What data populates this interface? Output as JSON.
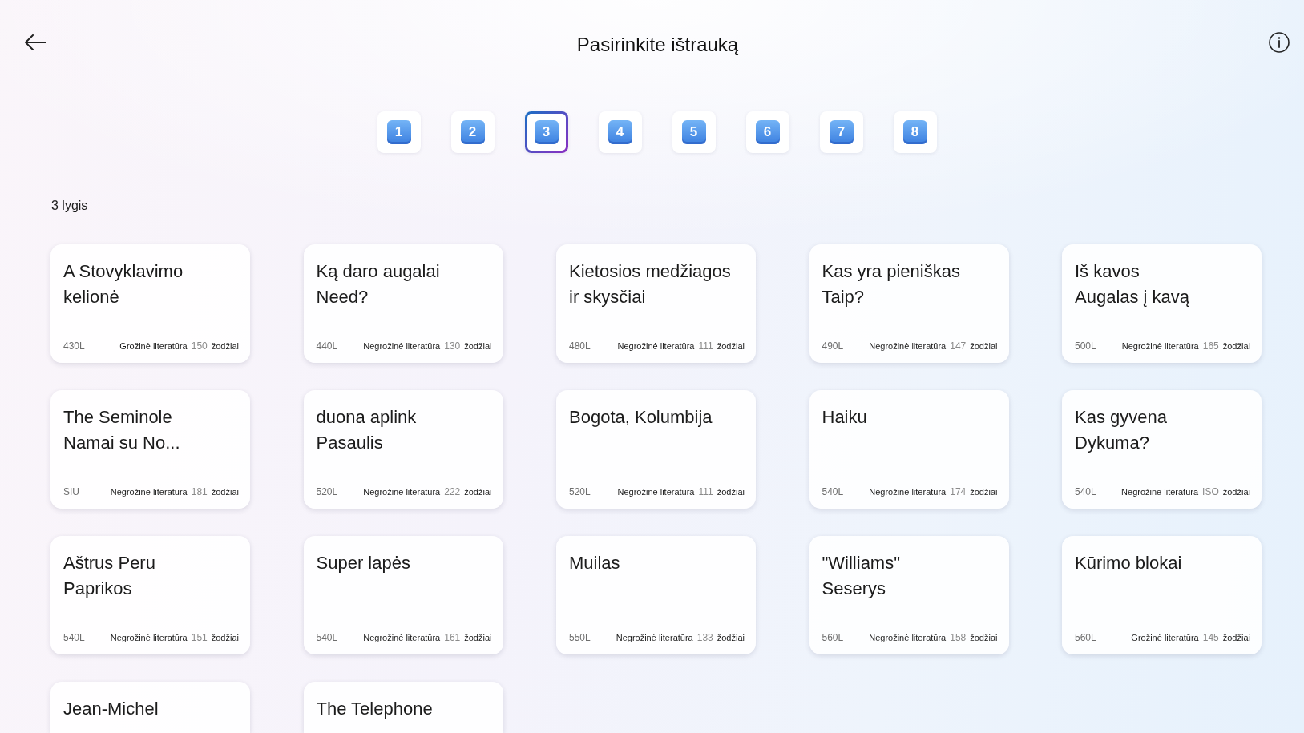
{
  "header": {
    "title": "Pasirinkite ištrauką"
  },
  "levels": [
    {
      "label": "1",
      "selected": false
    },
    {
      "label": "2",
      "selected": false
    },
    {
      "label": "3",
      "selected": true
    },
    {
      "label": "4",
      "selected": false
    },
    {
      "label": "5",
      "selected": false
    },
    {
      "label": "6",
      "selected": false
    },
    {
      "label": "7",
      "selected": false
    },
    {
      "label": "8",
      "selected": false
    }
  ],
  "level_heading": "3 lygis",
  "cards": [
    {
      "title": "A Stovyklavimo kelionė",
      "reading_level": "430L",
      "genre": "Grožinė literatūra",
      "count": "150",
      "words": "žodžiai"
    },
    {
      "title": "Ką daro augalai\nNeed?",
      "reading_level": "440L",
      "genre": "Negrožinė literatūra",
      "count": "130",
      "words": "žodžiai"
    },
    {
      "title": "Kietosios medžiagos ir skysčiai",
      "reading_level": "480L",
      "genre": "Negrožinė literatūra",
      "count": "111",
      "words": "žodžiai"
    },
    {
      "title": "Kas yra pieniškas\nTaip?",
      "reading_level": "490L",
      "genre": "Negrožinė literatūra",
      "count": "147",
      "words": "žodžiai"
    },
    {
      "title": "Iš kavos\nAugalas į kavą",
      "reading_level": "500L",
      "genre": "Negrožinė literatūra",
      "count": "165",
      "words": "žodžiai"
    },
    {
      "title": "The Seminole\nNamai su No...",
      "reading_level": "SIU",
      "genre": "Negrožinė literatūra",
      "count": "181",
      "words": "žodžiai"
    },
    {
      "title": "duona aplink\nPasaulis",
      "reading_level": "520L",
      "genre": "Negrožinė literatūra",
      "count": "222",
      "words": "žodžiai"
    },
    {
      "title": "Bogota, Kolumbija",
      "reading_level": "520L",
      "genre": "Negrožinė literatūra",
      "count": "111",
      "words": "žodžiai"
    },
    {
      "title": "Haiku",
      "reading_level": "540L",
      "genre": "Negrožinė literatūra",
      "count": "174",
      "words": "žodžiai"
    },
    {
      "title": "Kas gyvena\nDykuma?",
      "reading_level": "540L",
      "genre": "Negrožinė literatūra",
      "count": "ISO",
      "words": "žodžiai"
    },
    {
      "title": "Aštrus Peru\nPaprikos",
      "reading_level": "540L",
      "genre": "Negrožinė literatūra",
      "count": "151",
      "words": "žodžiai"
    },
    {
      "title": "Super lapės",
      "reading_level": "540L",
      "genre": "Negrožinė literatūra",
      "count": "161",
      "words": "žodžiai"
    },
    {
      "title": "Muilas",
      "reading_level": "550L",
      "genre": "Negrožinė literatūra",
      "count": "133",
      "words": "žodžiai"
    },
    {
      "title": "\"Williams\"\nSeserys",
      "reading_level": "560L",
      "genre": "Negrožinė literatūra",
      "count": "158",
      "words": "žodžiai"
    },
    {
      "title": "Kūrimo blokai",
      "reading_level": "560L",
      "genre": "Grožinė literatūra",
      "count": "145",
      "words": "žodžiai"
    },
    {
      "title": "Jean-Michel"
    },
    {
      "title": "The Telephone"
    }
  ]
}
